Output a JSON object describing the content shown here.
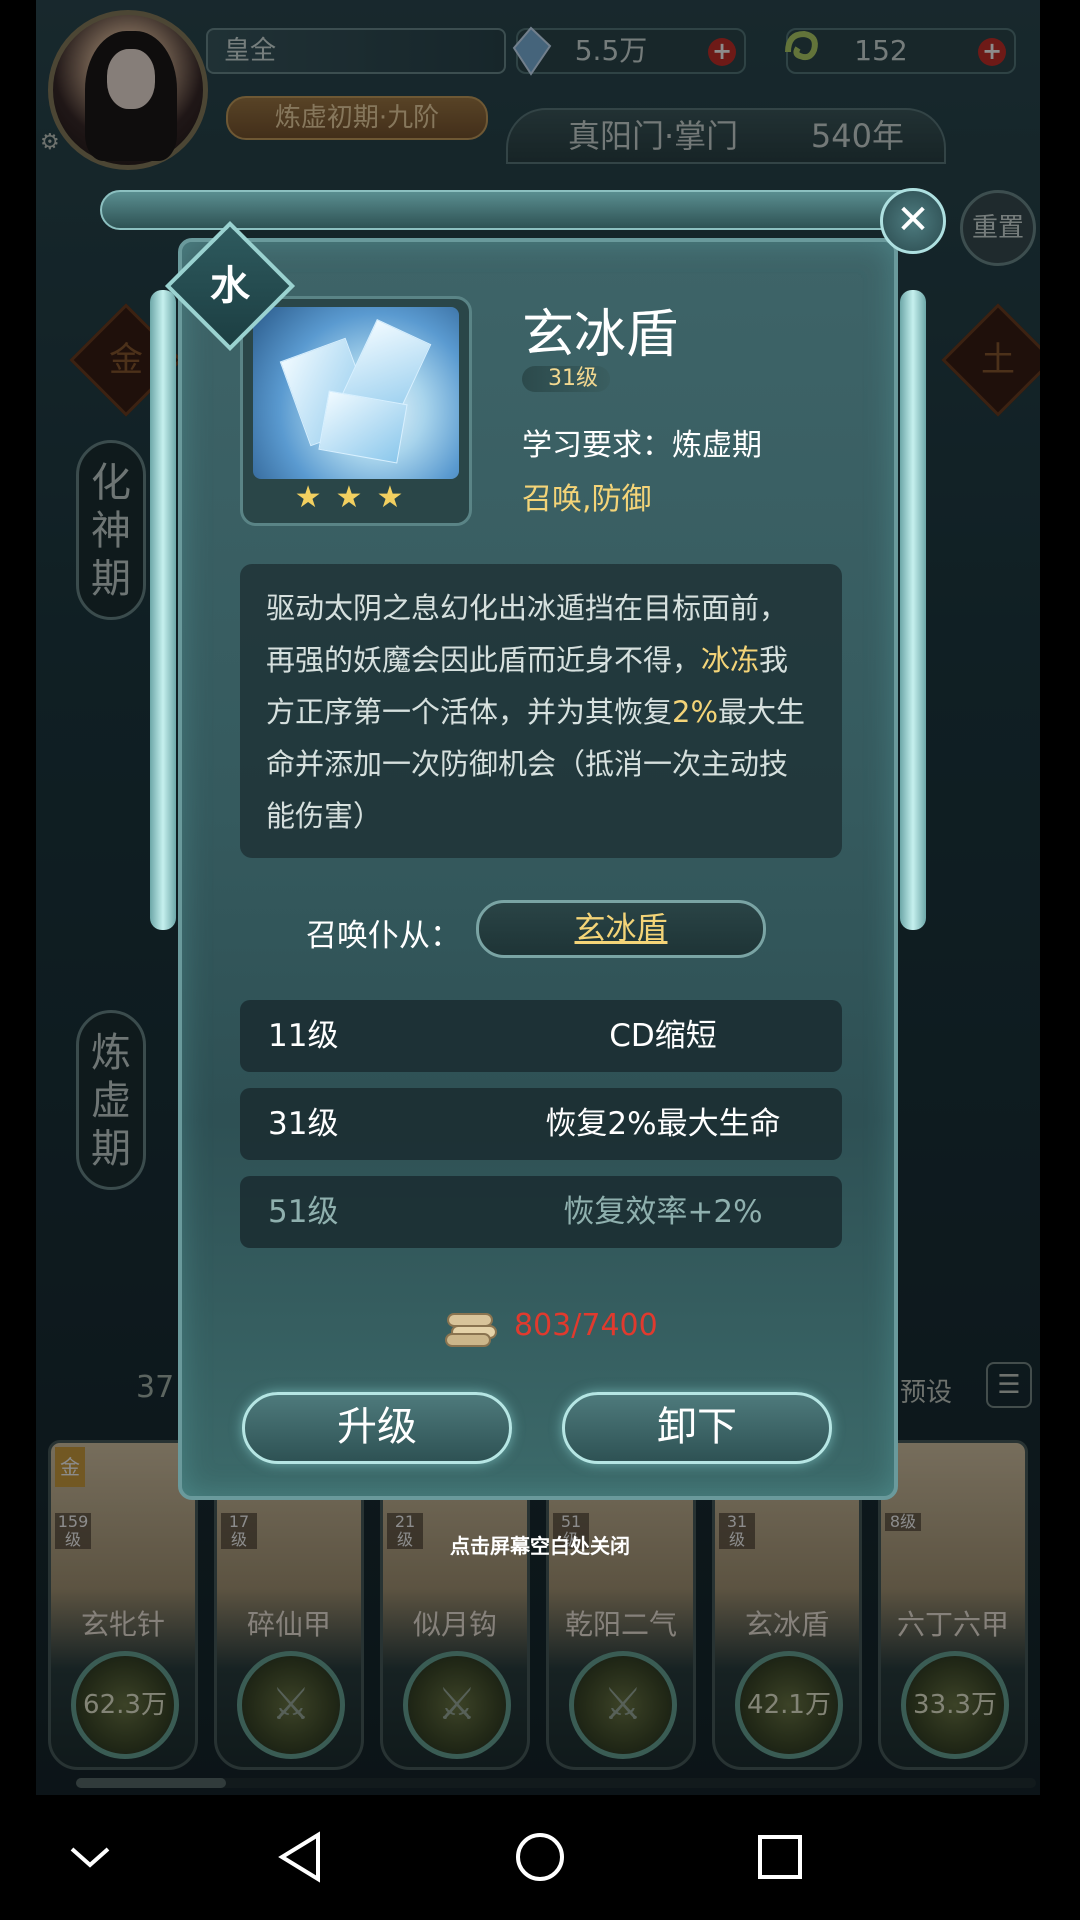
{
  "hud": {
    "player_name": "皇全",
    "realm": "炼虚初期·九阶",
    "spirit_stones": "5.5万",
    "jade": "152",
    "sect": "真阳门·掌门",
    "years": "540年",
    "reset_label": "重置"
  },
  "background": {
    "side_tab_1": "化神期",
    "side_tab_2": "炼虚期",
    "element_left": "金",
    "element_right": "土",
    "count": "37",
    "preset_label": "预设"
  },
  "modal": {
    "element": "水",
    "skill_name": "玄冰盾",
    "level": "31级",
    "stars": "★★★",
    "requirement": "学习要求：炼虚期",
    "tags": "召唤,防御",
    "description": [
      {
        "text": "驱动太阴之息幻化出冰遁挡在目标面前，再强的妖魔会因此盾而近身不得，",
        "highlight": false
      },
      {
        "text": "冰冻",
        "highlight": true
      },
      {
        "text": "我方正序第一个活体，并为其恢复",
        "highlight": false
      },
      {
        "text": "2%",
        "highlight": true
      },
      {
        "text": "最大生命并添加一次防御机会（抵消一次主动技能伤害）",
        "highlight": false
      }
    ],
    "summon_label": "召唤仆从：",
    "summon_value": "玄冰盾",
    "bonuses": [
      {
        "level": "11级",
        "effect": "CD缩短",
        "locked": false
      },
      {
        "level": "31级",
        "effect": "恢复2%最大生命",
        "locked": false
      },
      {
        "level": "51级",
        "effect": "恢复效率+2%",
        "locked": true
      }
    ],
    "cost": "803/7400",
    "upgrade_label": "升级",
    "unequip_label": "卸下",
    "close_hint": "点击屏幕空白处关闭"
  },
  "cards": [
    {
      "name": "玄牝针",
      "level": "159级",
      "power": "62.3万",
      "tag": "金"
    },
    {
      "name": "碎仙甲",
      "level": "17级",
      "power": ""
    },
    {
      "name": "似月钩",
      "level": "21级",
      "power": ""
    },
    {
      "name": "乾阳二气",
      "level": "51级",
      "power": ""
    },
    {
      "name": "玄冰盾",
      "level": "31级",
      "power": "42.1万"
    },
    {
      "name": "六丁六甲",
      "level": "8级",
      "power": "33.3万"
    }
  ],
  "colors": {
    "highlight": "#f4d478",
    "cost_insufficient": "#e03a2e",
    "panel": "#355a5e"
  },
  "progress": {
    "cards_scroll_fraction": 0.15
  }
}
